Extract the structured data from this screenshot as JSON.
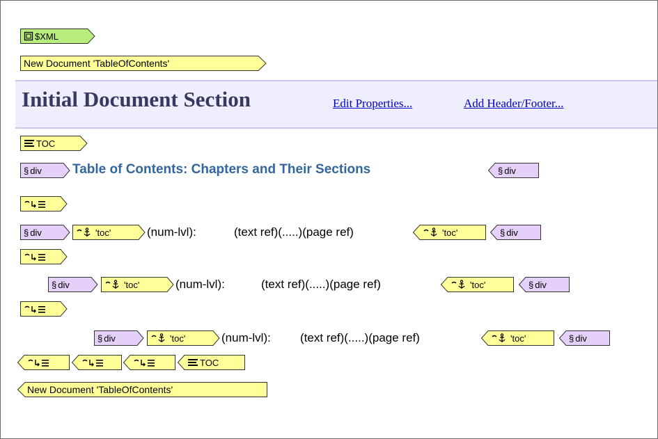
{
  "colors": {
    "xml_tag_fill": "#b8ec7c",
    "tag_fill": "#ffff99",
    "div_tag_fill": "#e4d0f8",
    "tag_border": "#333333",
    "section_band": "#eeeeff",
    "section_title": "#383860",
    "link": "#0000cc",
    "heading": "#33669a"
  },
  "tags": {
    "xml": "$XML",
    "new_doc": "New Document 'TableOfContents'",
    "toc": "TOC",
    "div": "div",
    "toc_bookmark": "'toc'"
  },
  "icons": {
    "xml": "document-icon",
    "toc": "toc-list-icon",
    "div": "section-sign-icon",
    "level": "toc-level-icon",
    "bookmark": "anchor-bookmark-icon"
  },
  "section": {
    "title": "Initial Document Section",
    "edit_link": "Edit Properties...",
    "header_link": "Add Header/Footer..."
  },
  "toc_heading": "Table of Contents: Chapters and Their Sections",
  "entry": {
    "num": "(num-lvl):",
    "ref": "(text ref)(.....)(page ref)"
  }
}
